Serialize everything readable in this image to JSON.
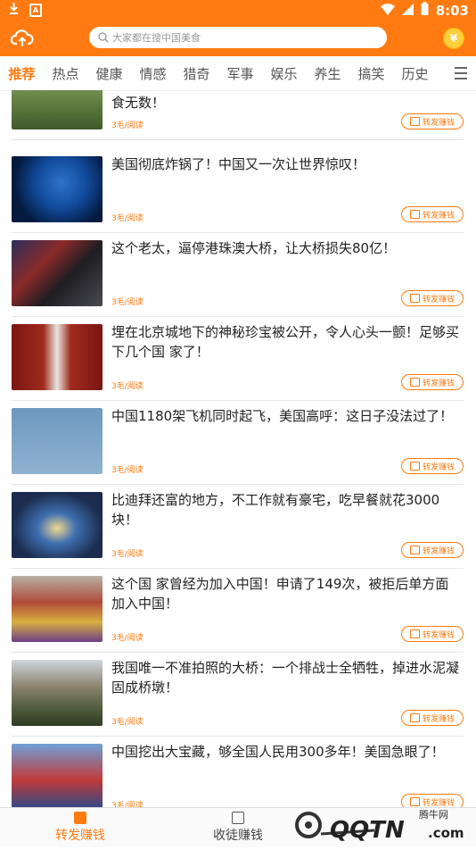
{
  "status_bar": {
    "time": "8:03",
    "left_icons": [
      "download-icon",
      "a-icon"
    ],
    "right_icons": [
      "wifi-icon",
      "signal-icon",
      "battery-icon"
    ]
  },
  "header": {
    "search_placeholder": "大家都在搜中国美食",
    "coin_symbol": "¥",
    "accent_color": "#ff7b11"
  },
  "tabs": [
    "推荐",
    "热点",
    "健康",
    "情感",
    "猎奇",
    "军事",
    "娱乐",
    "养生",
    "搞笑",
    "历史"
  ],
  "active_tab": "推荐",
  "articles": [
    {
      "title": "食无数！",
      "price": "3毛/阅读",
      "share_label": "转发赚钱"
    },
    {
      "title": "美国彻底炸锅了！中国又一次让世界惊叹！",
      "price": "3毛/阅读",
      "share_label": "转发赚钱"
    },
    {
      "title": "这个老太，逼停港珠澳大桥，让大桥损失80亿！",
      "price": "3毛/阅读",
      "share_label": "转发赚钱"
    },
    {
      "title": "埋在北京城地下的神秘珍宝被公开，令人心头一颤！足够买下几个国 家了！",
      "price": "3毛/阅读",
      "share_label": "转发赚钱"
    },
    {
      "title": "中国1180架飞机同时起飞，美国高呼：这日子没法过了！",
      "price": "3毛/阅读",
      "share_label": "转发赚钱"
    },
    {
      "title": "比迪拜还富的地方，不工作就有豪宅，吃早餐就花3000块！",
      "price": "3毛/阅读",
      "share_label": "转发赚钱"
    },
    {
      "title": "这个国 家曾经为加入中国！申请了149次，被拒后单方面加入中国！",
      "price": "3毛/阅读",
      "share_label": "转发赚钱"
    },
    {
      "title": "我国唯一不准拍照的大桥：一个排战士全牺牲，掉进水泥凝固成桥墩！",
      "price": "3毛/阅读",
      "share_label": "转发赚钱"
    },
    {
      "title": "中国挖出大宝藏，够全国人民用300多年！美国急眼了！",
      "price": "3毛/阅读",
      "share_label": "转发赚钱"
    }
  ],
  "bottom_nav": {
    "item1": "转发赚钱",
    "item2": "收徒赚钱"
  },
  "watermark": {
    "site": "腾牛网",
    "logo_text": "QQTN.com"
  }
}
